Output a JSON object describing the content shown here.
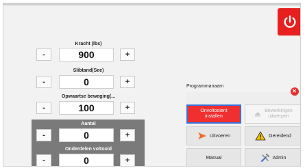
{
  "power": {
    "icon": "power-icon",
    "color": "#e81f1f"
  },
  "parameters": [
    {
      "label": "Kracht (lbs)",
      "value": "900",
      "minus": "-",
      "plus": "+"
    },
    {
      "label": "Slibtand(See)",
      "value": "0",
      "minus": "-",
      "plus": "+"
    },
    {
      "label": "Opwaartse beweging(...",
      "value": "100",
      "minus": "-",
      "plus": "+"
    }
  ],
  "panel": {
    "color": "#7a7a7a",
    "aantal": {
      "label": "Aantal",
      "value": "0",
      "minus": "-",
      "plus": "+"
    },
    "onderdelen": {
      "label": "Onderdelen voltooid",
      "value": "0",
      "minus": "-",
      "plus": "+"
    }
  },
  "program": {
    "label": "Programmanaam",
    "value": ""
  },
  "tiles": {
    "install": {
      "line1": "Onvoltooient",
      "line2": "installen",
      "color": "#f03030"
    },
    "remove": {
      "line1": "Bewerkingen",
      "line2": "uitwerpen"
    },
    "uitvoeren": {
      "label": "Uitvoeren",
      "icon": "play-triangle-icon"
    },
    "gereed": {
      "label": "Gereidend",
      "icon": "warning-icon"
    },
    "manual": {
      "label": "Manual"
    },
    "admin": {
      "label": "Admin",
      "icon": "tools-icon"
    }
  }
}
